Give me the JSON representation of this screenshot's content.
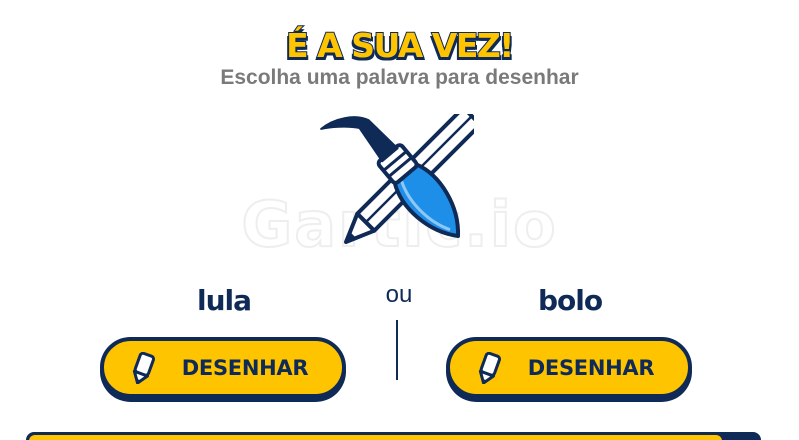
{
  "title": "É A SUA VEZ!",
  "subtitle": "Escolha uma palavra para desenhar",
  "watermark": "Gartic.io",
  "choices": [
    {
      "word": "lula",
      "button_label": "DESENHAR"
    },
    {
      "word": "bolo",
      "button_label": "DESENHAR"
    }
  ],
  "separator_text": "ou",
  "timer": {
    "remaining_fraction": 0.95
  },
  "colors": {
    "accent": "#ffc400",
    "dark": "#0f2a56",
    "brush_blue": "#1e8fe8",
    "subtitle_gray": "#7a7a7a"
  },
  "icons": {
    "illustration": "brush-and-pencil-icon",
    "button": "pencil-icon"
  }
}
